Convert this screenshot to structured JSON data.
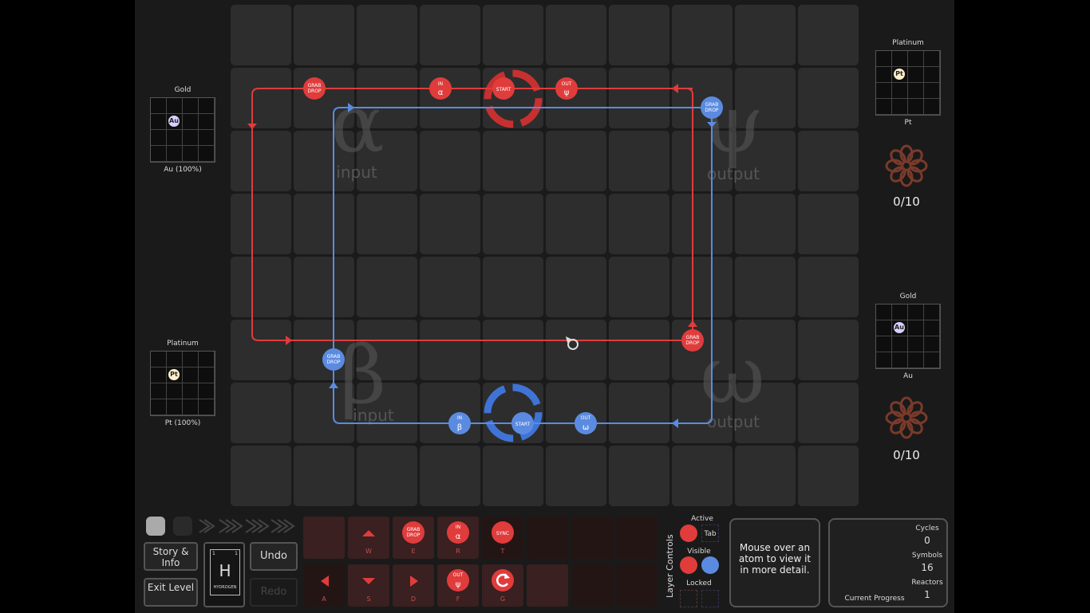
{
  "left_panel": {
    "input_alpha": {
      "title": "Gold",
      "atom": "Au",
      "caption": "Au (100%)"
    },
    "input_beta": {
      "title": "Platinum",
      "atom": "Pt",
      "caption": "Pt (100%)"
    }
  },
  "right_panel": {
    "output_psi": {
      "title": "Platinum",
      "atom": "Pt",
      "caption": "Pt",
      "progress": "0/10"
    },
    "output_omega": {
      "title": "Gold",
      "atom": "Au",
      "caption": "Au",
      "progress": "0/10"
    }
  },
  "board": {
    "zones": {
      "alpha": "α",
      "alpha_label": "input",
      "psi": "ψ",
      "psi_label": "output",
      "beta": "β",
      "beta_label": "input",
      "omega": "ω",
      "omega_label": "output"
    },
    "red_instructions": {
      "grab1": "GRAB\nDROP",
      "in": "IN",
      "in_sym": "α",
      "start": "START",
      "out": "OUT",
      "out_sym": "ψ",
      "grab2": "GRAB\nDROP"
    },
    "blue_instructions": {
      "grab1": "GRAB\nDROP",
      "grab2": "GRAB\nDROP",
      "in": "IN",
      "in_sym": "β",
      "start": "START",
      "out": "OUT",
      "out_sym": "ω"
    }
  },
  "bottom": {
    "story_button": "Story & Info",
    "exit_button": "Exit Level",
    "undo_button": "Undo",
    "redo_button": "Redo",
    "element": {
      "symbol": "H",
      "name": "HYDROGEN",
      "num_left": "1",
      "num_right": "1"
    },
    "palette": {
      "grab": "GRAB DROP",
      "in": "IN",
      "in_sym": "α",
      "sync": "SYNC",
      "out": "OUT",
      "out_sym": "ψ",
      "keys": {
        "w": "W",
        "e": "E",
        "r": "R",
        "t": "T",
        "a": "A",
        "s": "S",
        "d": "D",
        "f": "F",
        "g": "G"
      }
    },
    "layer_controls": {
      "title": "Layer Controls",
      "active": "Active",
      "tab": "Tab",
      "visible": "Visible",
      "locked": "Locked"
    },
    "hint": "Mouse over an atom to view it in more detail.",
    "stats": {
      "cycles_label": "Cycles",
      "cycles": "0",
      "symbols_label": "Symbols",
      "symbols": "16",
      "reactors_label": "Reactors",
      "reactors": "1",
      "progress_label": "Current Progress"
    }
  },
  "colors": {
    "red": "#e03c3c",
    "blue": "#5b8be0",
    "cell": "#2d2d2d"
  }
}
